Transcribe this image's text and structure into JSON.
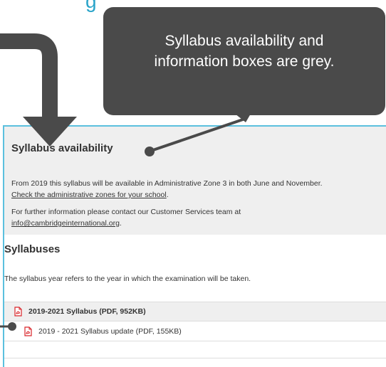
{
  "banner": {
    "heading_fragment": "g"
  },
  "callout": {
    "line1": "Syllabus availability and",
    "line2": "information boxes are grey."
  },
  "availability": {
    "title": "Syllabus availability",
    "text1": "From 2019 this syllabus will be available in Administrative Zone 3 in both June and November.",
    "link1": "Check the administrative zones for your school",
    "link1_suffix": ".",
    "text2": "For further information please contact our Customer Services team at",
    "email": "info@cambridgeinternational.org",
    "email_suffix": "."
  },
  "syllabuses": {
    "title": "Syllabuses",
    "description": "The syllabus year refers to the year in which the examination will be taken.",
    "items": [
      {
        "label": "2019-2021 Syllabus (PDF, 952KB)"
      },
      {
        "label": "2019 - 2021 Syllabus update (PDF, 155KB)"
      }
    ]
  },
  "colors": {
    "callout_bg": "#4a4a4a",
    "grey_box": "#efefef",
    "frame_border": "#5bc0de",
    "pdf_red": "#d9262b",
    "heading_blue": "#2aa4c9"
  },
  "icons": {
    "document": "pdf-icon"
  }
}
